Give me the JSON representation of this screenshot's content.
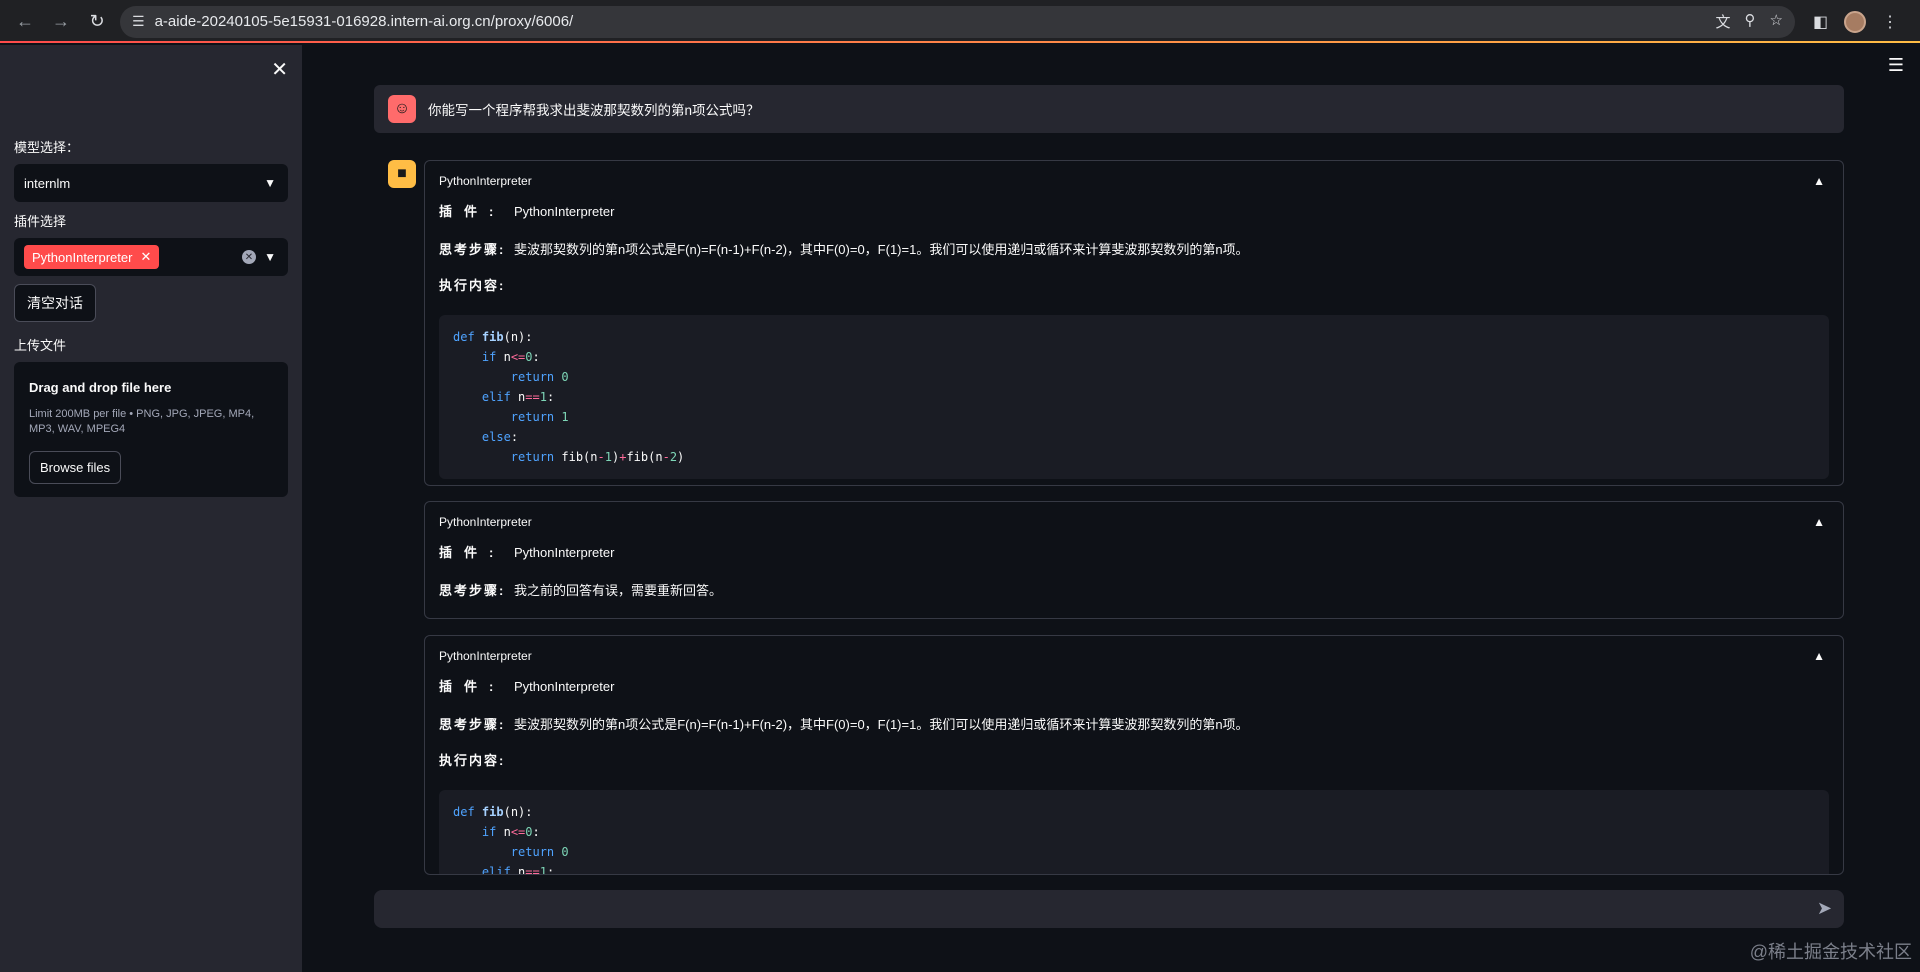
{
  "browser": {
    "url": "a-aide-20240105-5e15931-016928.intern-ai.org.cn/proxy/6006/"
  },
  "sidebar": {
    "model_label": "模型选择：",
    "model_value": "internlm",
    "plugin_label": "插件选择",
    "plugin_tag": "PythonInterpreter",
    "clear_button": "清空对话",
    "upload_label": "上传文件",
    "upload_title": "Drag and drop file here",
    "upload_limit": "Limit 200MB per file • PNG, JPG, JPEG, MP4, MP3, WAV, MPEG4",
    "browse_button": "Browse files"
  },
  "chat": {
    "user_message": "你能写一个程序帮我求出斐波那契数列的第n项公式吗？",
    "blocks": [
      {
        "header": "PythonInterpreter",
        "plugin_key": "插件:",
        "plugin_val": "PythonInterpreter",
        "thought_key": "思考步骤:",
        "thought_val": "斐波那契数列的第n项公式是F(n)=F(n-1)+F(n-2)，其中F(0)=0，F(1)=1。我们可以使用递归或循环来计算斐波那契数列的第n项。",
        "exec_key": "执行内容:"
      },
      {
        "header": "PythonInterpreter",
        "plugin_key": "插件:",
        "plugin_val": "PythonInterpreter",
        "thought_key": "思考步骤:",
        "thought_val": "我之前的回答有误，需要重新回答。"
      },
      {
        "header": "PythonInterpreter",
        "plugin_key": "插件:",
        "plugin_val": "PythonInterpreter",
        "thought_key": "思考步骤:",
        "thought_val": "斐波那契数列的第n项公式是F(n)=F(n-1)+F(n-2)，其中F(0)=0，F(1)=1。我们可以使用递归或循环来计算斐波那契数列的第n项。",
        "exec_key": "执行内容:"
      }
    ]
  },
  "watermark": "@稀土掘金技术社区",
  "colors": {
    "accent": "#ff4b4b",
    "bot_avatar": "#ffbd45",
    "sidebar_bg": "#262730",
    "main_bg": "#0e1117"
  }
}
